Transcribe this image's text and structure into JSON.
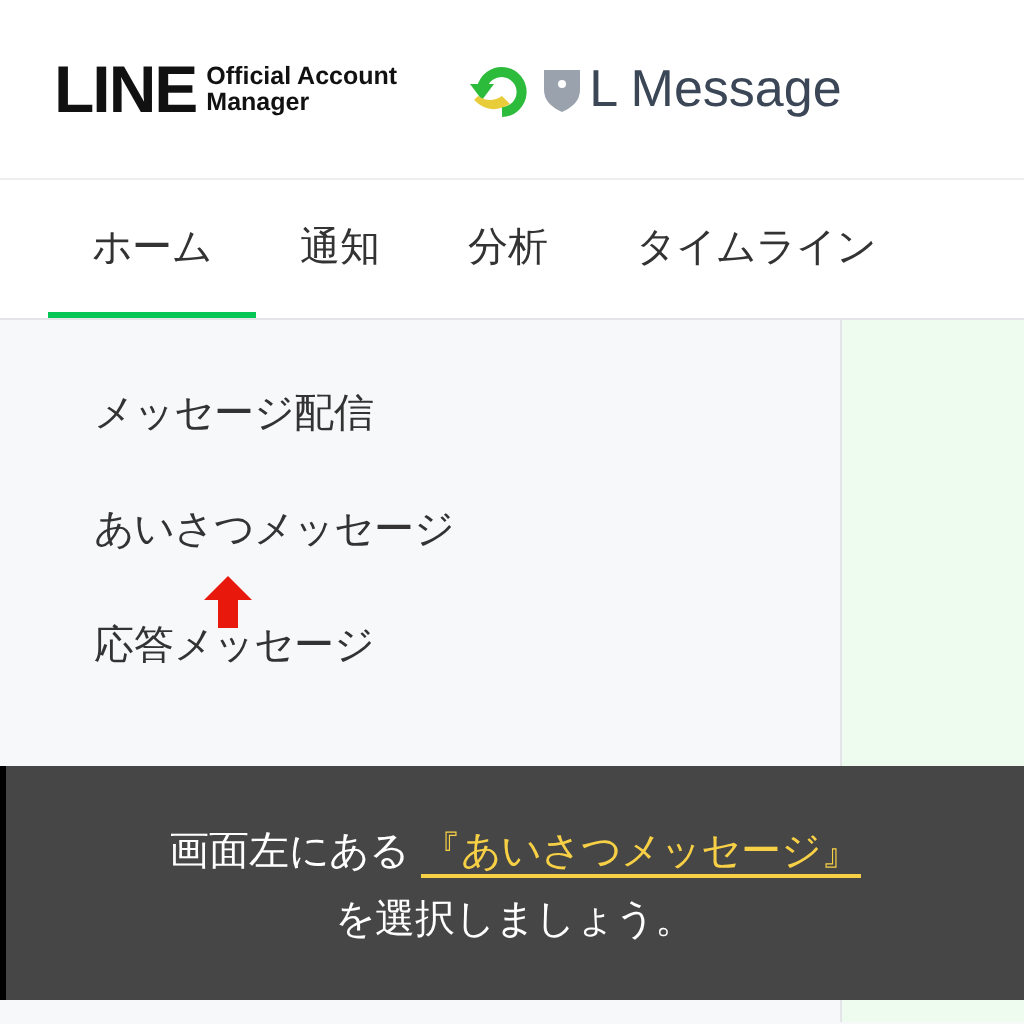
{
  "header": {
    "logo_word": "LINE",
    "logo_sub": [
      "Official Account",
      "Manager"
    ],
    "account_name": "L Message"
  },
  "tabs": [
    {
      "label": "ホーム",
      "selected": true
    },
    {
      "label": "通知",
      "selected": false
    },
    {
      "label": "分析",
      "selected": false
    },
    {
      "label": "タイムライン",
      "selected": false
    }
  ],
  "sidebar": {
    "items": [
      {
        "label": "メッセージ配信"
      },
      {
        "label": "あいさつメッセージ"
      },
      {
        "label": "応答メッセージ"
      }
    ]
  },
  "caption": {
    "lines": [
      [
        {
          "text": "画面左にある",
          "kind": "plain"
        },
        {
          "text": "『あいさつメッセージ』",
          "kind": "highlight"
        }
      ],
      [
        {
          "text": "を選択しましょう。",
          "kind": "plain"
        }
      ]
    ]
  }
}
